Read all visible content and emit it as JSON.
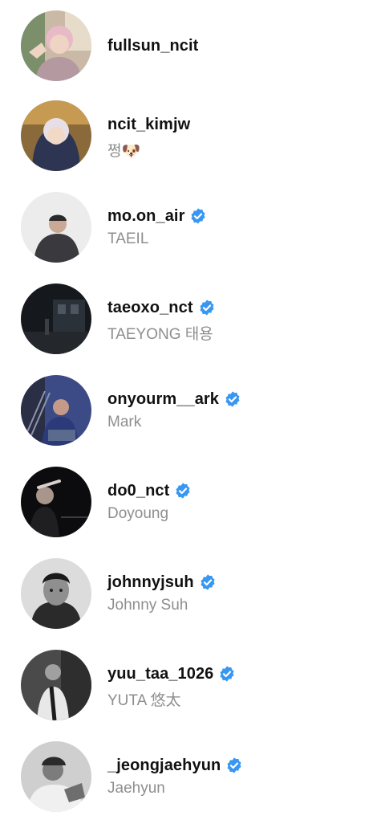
{
  "accounts": [
    {
      "username": "fullsun_ncit",
      "subtitle": "",
      "verified": false,
      "avatar": "avatar-pink-hair"
    },
    {
      "username": "ncit_kimjw",
      "subtitle": "쩡🐶",
      "verified": false,
      "avatar": "avatar-hoodie"
    },
    {
      "username": "mo.on_air",
      "subtitle": "TAEIL",
      "verified": true,
      "avatar": "avatar-light-bg"
    },
    {
      "username": "taeoxo_nct",
      "subtitle": "TAEYONG 태용",
      "verified": true,
      "avatar": "avatar-night-street"
    },
    {
      "username": "onyourm__ark",
      "subtitle": "Mark",
      "verified": true,
      "avatar": "avatar-stairs"
    },
    {
      "username": "do0_nct",
      "subtitle": "Doyoung",
      "verified": true,
      "avatar": "avatar-dark"
    },
    {
      "username": "johnnyjsuh",
      "subtitle": "Johnny Suh",
      "verified": true,
      "avatar": "avatar-bw-portrait"
    },
    {
      "username": "yuu_taa_1026",
      "subtitle": "YUTA 悠太",
      "verified": true,
      "avatar": "avatar-bw-dark"
    },
    {
      "username": "_jeongjaehyun",
      "subtitle": "Jaehyun",
      "verified": true,
      "avatar": "avatar-bw-hands"
    }
  ],
  "colors": {
    "verified_blue": "#3897f0",
    "subtitle_gray": "#8e8e8e",
    "username_black": "#111111"
  }
}
